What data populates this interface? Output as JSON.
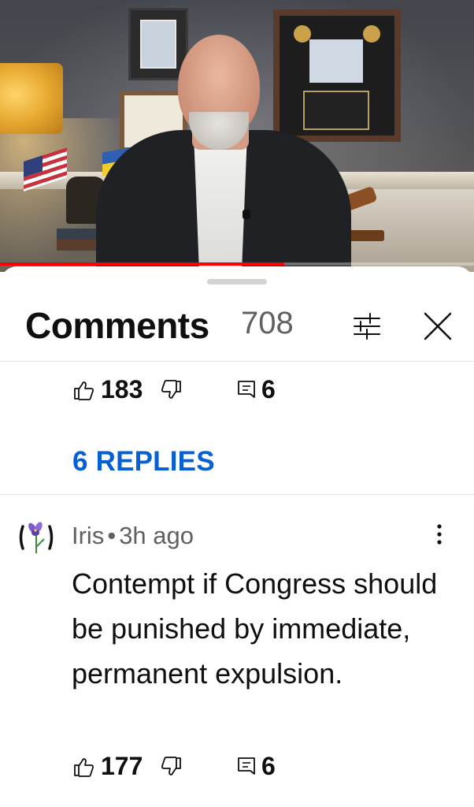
{
  "video": {
    "progress_fraction": 0.6
  },
  "header": {
    "title": "Comments",
    "count": "708",
    "filter_icon": "sliders-icon",
    "close_icon": "close-icon"
  },
  "thread_above": {
    "like_count": "183",
    "reply_count": "6",
    "replies_link": "6 REPLIES"
  },
  "comment": {
    "author": "Iris",
    "separator": "•",
    "time": "3h ago",
    "text": "Contempt if Congress should be punished by immediate, permanent expulsion.",
    "like_count": "177",
    "reply_count": "6"
  },
  "colors": {
    "accent_link": "#065fd4",
    "progress": "#ff0000",
    "secondary_text": "#606060"
  }
}
